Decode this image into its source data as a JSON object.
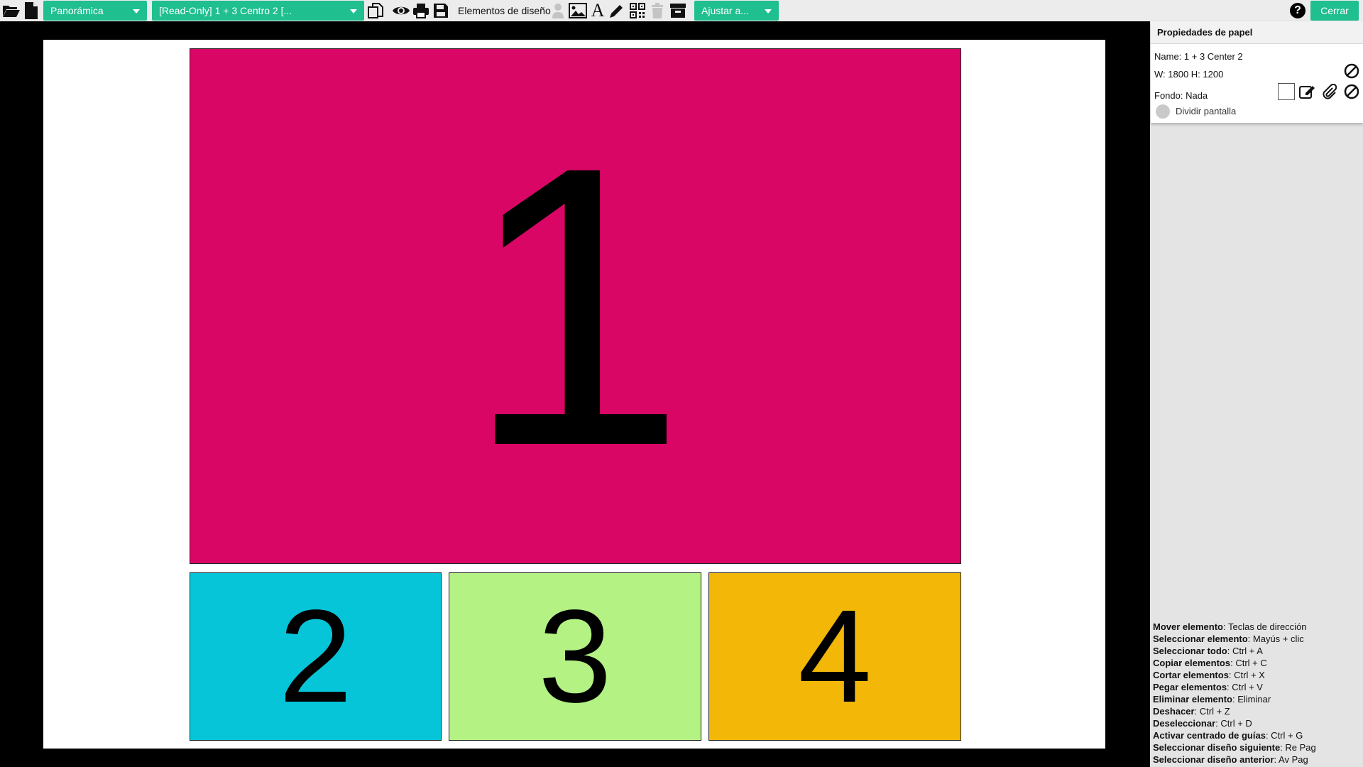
{
  "toolbar": {
    "view_dropdown": "Panorámica",
    "layout_dropdown": "[Read-Only] 1 + 3 Centro 2 [...",
    "design_elements_label": "Elementos de diseño",
    "fit_dropdown": "Ajustar a...",
    "close_button": "Cerrar",
    "help_label": "?",
    "icons": [
      "folder-open-icon",
      "new-document-icon",
      "duplicate-icon",
      "preview-eye-icon",
      "print-icon",
      "save-icon",
      "user-icon",
      "image-icon",
      "text-icon",
      "pencil-icon",
      "qr-code-icon",
      "trash-icon",
      "archive-icon",
      "help-icon"
    ]
  },
  "canvas": {
    "zones": [
      {
        "label": "1",
        "color": "#d90666"
      },
      {
        "label": "2",
        "color": "#06c5d9"
      },
      {
        "label": "3",
        "color": "#b3f283"
      },
      {
        "label": "4",
        "color": "#f2b707"
      }
    ]
  },
  "properties": {
    "title": "Propiedades de papel",
    "name": "Name: 1 + 3 Center 2",
    "dimensions": "W: 1800 H: 1200",
    "background": "Fondo: Nada",
    "split_screen_label": "Dividir pantalla",
    "split_screen_enabled": false
  },
  "shortcuts": [
    {
      "action": "Mover elemento",
      "keys": ": Teclas de dirección"
    },
    {
      "action": "Seleccionar elemento",
      "keys": ": Mayús + clic"
    },
    {
      "action": "Seleccionar todo",
      "keys": ": Ctrl + A"
    },
    {
      "action": "Copiar elementos",
      "keys": ": Ctrl + C"
    },
    {
      "action": "Cortar elementos",
      "keys": ": Ctrl + X"
    },
    {
      "action": "Pegar elementos",
      "keys": ": Ctrl + V"
    },
    {
      "action": "Eliminar elemento",
      "keys": ": Eliminar"
    },
    {
      "action": "Deshacer",
      "keys": ": Ctrl + Z"
    },
    {
      "action": "Deseleccionar",
      "keys": ": Ctrl + D"
    },
    {
      "action": "Activar centrado de guías",
      "keys": ": Ctrl + G"
    },
    {
      "action": "Seleccionar diseño siguiente",
      "keys": ": Re Pag"
    },
    {
      "action": "Seleccionar diseño anterior",
      "keys": ": Av Pag"
    }
  ],
  "colors": {
    "accent": "#1fbf8f",
    "toolbar_bg": "#ececec",
    "panel_bg": "#e4e4e4"
  }
}
